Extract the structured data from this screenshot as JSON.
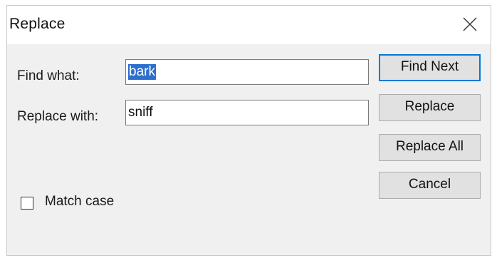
{
  "window": {
    "title": "Replace",
    "close_icon": "close-icon"
  },
  "find": {
    "label": "Find what:",
    "value": "bark"
  },
  "replace": {
    "label": "Replace with:",
    "value": "sniff"
  },
  "buttons": {
    "find_next": "Find Next",
    "replace": "Replace",
    "replace_all": "Replace All",
    "cancel": "Cancel"
  },
  "options": {
    "match_case_label": "Match case",
    "match_case_checked": false
  },
  "colors": {
    "accent": "#0078d7",
    "selection": "#2d6fcf",
    "dialog_bg": "#f0f0f0"
  }
}
